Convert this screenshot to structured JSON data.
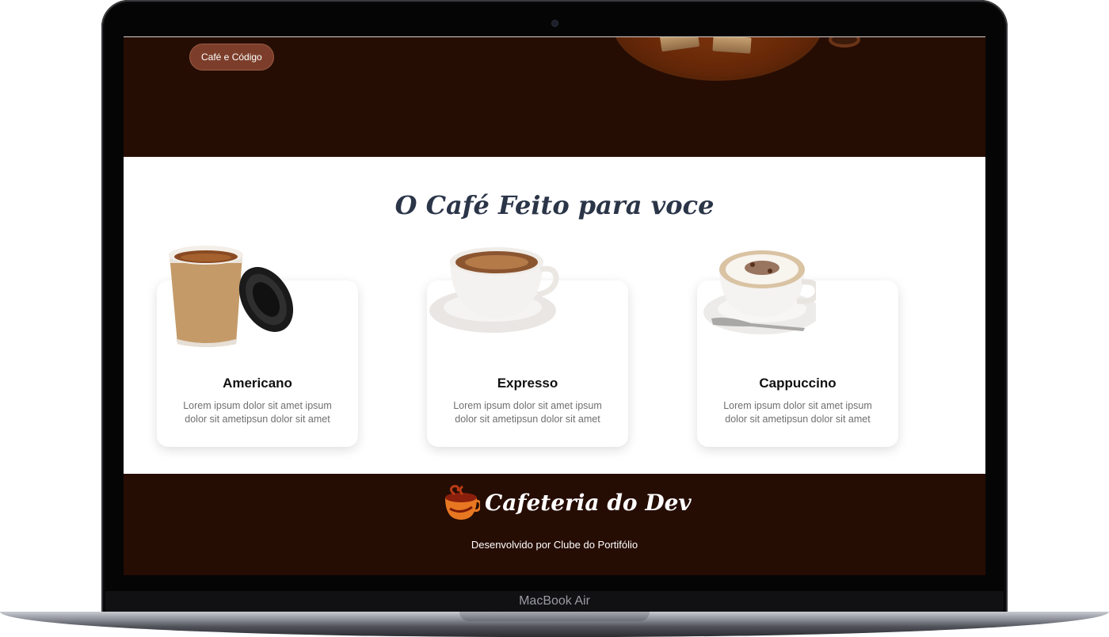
{
  "device": {
    "model_label": "MacBook Air"
  },
  "hero": {
    "pill_label": "Café e Código"
  },
  "menu": {
    "title": "O Café Feito para voce",
    "cards": [
      {
        "name": "Americano",
        "description": "Lorem ipsum dolor sit amet ipsum dolor sit ametipsun dolor sit amet",
        "image_icon": "paper-coffee-cup-icon"
      },
      {
        "name": "Expresso",
        "description": "Lorem ipsum dolor sit amet ipsum dolor sit ametipsun dolor sit amet",
        "image_icon": "espresso-cup-icon"
      },
      {
        "name": "Cappuccino",
        "description": "Lorem ipsum dolor sit amet ipsum dolor sit ametipsun dolor sit amet",
        "image_icon": "cappuccino-cup-icon"
      }
    ]
  },
  "footer": {
    "brand": "Cafeteria do Dev",
    "credit": "Desenvolvido por Clube do Portifólio"
  },
  "colors": {
    "dark_brown": "#260d04",
    "pill_brown": "#7c3e2a",
    "title_navy": "#2b3548",
    "text_grey": "#6f6f6f"
  }
}
